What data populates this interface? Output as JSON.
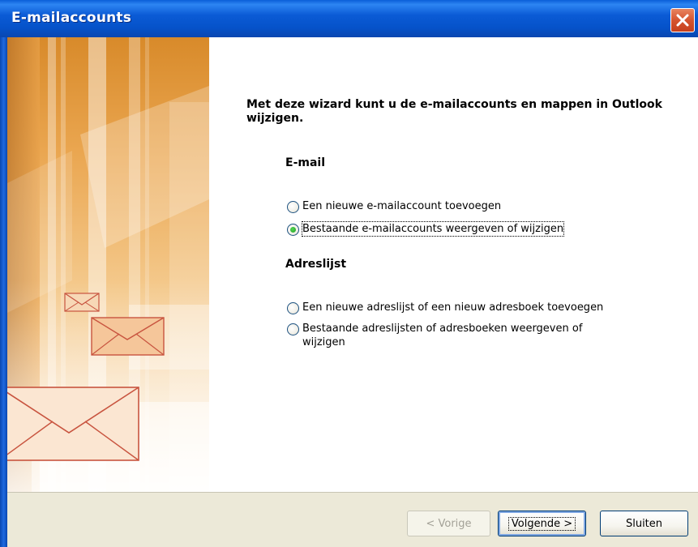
{
  "window": {
    "title": "E-mailaccounts",
    "close_label": "close"
  },
  "main": {
    "heading": "Met deze wizard kunt u de e-mailaccounts en mappen in Outlook wijzigen.",
    "email_section": {
      "title": "E-mail",
      "options": [
        {
          "label": "Een nieuwe e-mailaccount toevoegen",
          "selected": false
        },
        {
          "label": "Bestaande e-mailaccounts weergeven of wijzigen",
          "selected": true
        }
      ]
    },
    "address_section": {
      "title": "Adreslijst",
      "options": [
        {
          "label": "Een nieuwe adreslijst of een nieuw adresboek toevoegen",
          "selected": false
        },
        {
          "label": "Bestaande adreslijsten of adresboeken weergeven of wijzigen",
          "selected": false
        }
      ]
    }
  },
  "footer": {
    "back_label": "< Vorige",
    "next_label": "Volgende >",
    "close_label": "Sluiten"
  },
  "colors": {
    "titlebar": "#0552c9",
    "close_button": "#d5542f",
    "art_orange": "#f0a94a",
    "envelope_stroke": "#c8543f"
  },
  "icons": [
    "close-icon",
    "envelope-icon",
    "radio-selected",
    "radio-unselected"
  ]
}
